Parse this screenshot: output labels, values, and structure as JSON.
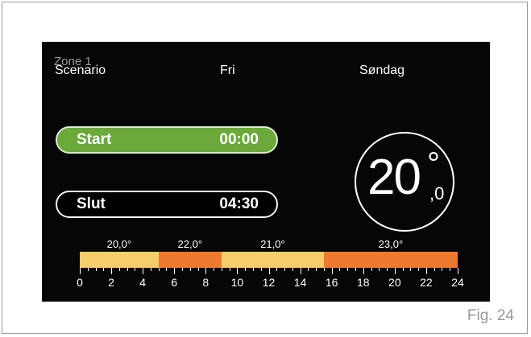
{
  "zone_label": "Zone 1",
  "header": {
    "scenario": "Scenario",
    "mode": "Fri",
    "day": "Søndag"
  },
  "start": {
    "label": "Start",
    "time": "00:00",
    "color": "#6aa93a"
  },
  "slut": {
    "label": "Slut",
    "time": "04:30"
  },
  "temperature": {
    "integer": "20",
    "degree": "°",
    "decimal": ",0"
  },
  "schedule": {
    "hour_range": [
      0,
      24
    ],
    "segments": [
      {
        "from": 0,
        "to": 5,
        "temp": "20,0°",
        "color": "#f7cd6c"
      },
      {
        "from": 5,
        "to": 9,
        "temp": "22,0°",
        "color": "#ee7a30"
      },
      {
        "from": 9,
        "to": 15.5,
        "temp": "21,0°",
        "color": "#f7cd6c"
      },
      {
        "from": 15.5,
        "to": 24,
        "temp": "23,0°",
        "color": "#ee7a30"
      }
    ],
    "tick_labels": [
      "0",
      "2",
      "4",
      "6",
      "8",
      "10",
      "12",
      "14",
      "16",
      "18",
      "20",
      "22",
      "24"
    ]
  },
  "figure_caption": "Fig. 24"
}
